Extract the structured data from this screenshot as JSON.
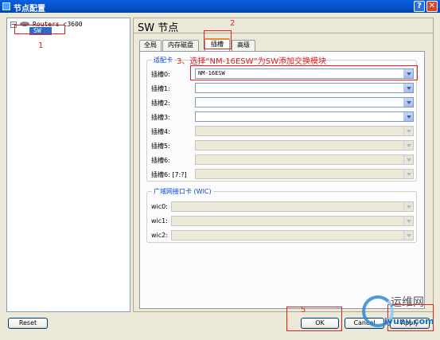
{
  "window": {
    "title": "节点配置",
    "help_label": "?",
    "close_label": "✕"
  },
  "tree": {
    "expander": "−",
    "router_label": "Routers c3600",
    "selected_node": "SW"
  },
  "panel": {
    "heading": "SW 节点"
  },
  "tabs": [
    {
      "label": "全局"
    },
    {
      "label": "内存磁盘"
    },
    {
      "label": "插槽"
    },
    {
      "label": "高级"
    }
  ],
  "adapters": {
    "group_label": "适配卡",
    "slots": [
      {
        "label": "插槽0:",
        "value": "NM-16ESW"
      },
      {
        "label": "插槽1:",
        "value": ""
      },
      {
        "label": "插槽2:",
        "value": ""
      },
      {
        "label": "插槽3:",
        "value": ""
      },
      {
        "label": "插槽4:",
        "value": ""
      },
      {
        "label": "插槽5:",
        "value": ""
      },
      {
        "label": "插槽6:",
        "value": ""
      },
      {
        "label": "插槽6: [7:?]",
        "value": ""
      }
    ]
  },
  "wic": {
    "group_label": "广域网接口卡 (WIC)",
    "slots": [
      {
        "label": "wic0:",
        "value": ""
      },
      {
        "label": "wic1:",
        "value": ""
      },
      {
        "label": "wic2:",
        "value": ""
      }
    ]
  },
  "buttons": {
    "reset": "Reset",
    "ok": "OK",
    "cancel": "Cancel",
    "apply": "Apply"
  },
  "annotations": {
    "n1": "1",
    "n2": "2",
    "n3_text": "3、选择“NM-16ESW”为SW添加交换模块",
    "n5": "5"
  },
  "watermark": {
    "cn": "运维网",
    "domain": "iyunv.com"
  }
}
